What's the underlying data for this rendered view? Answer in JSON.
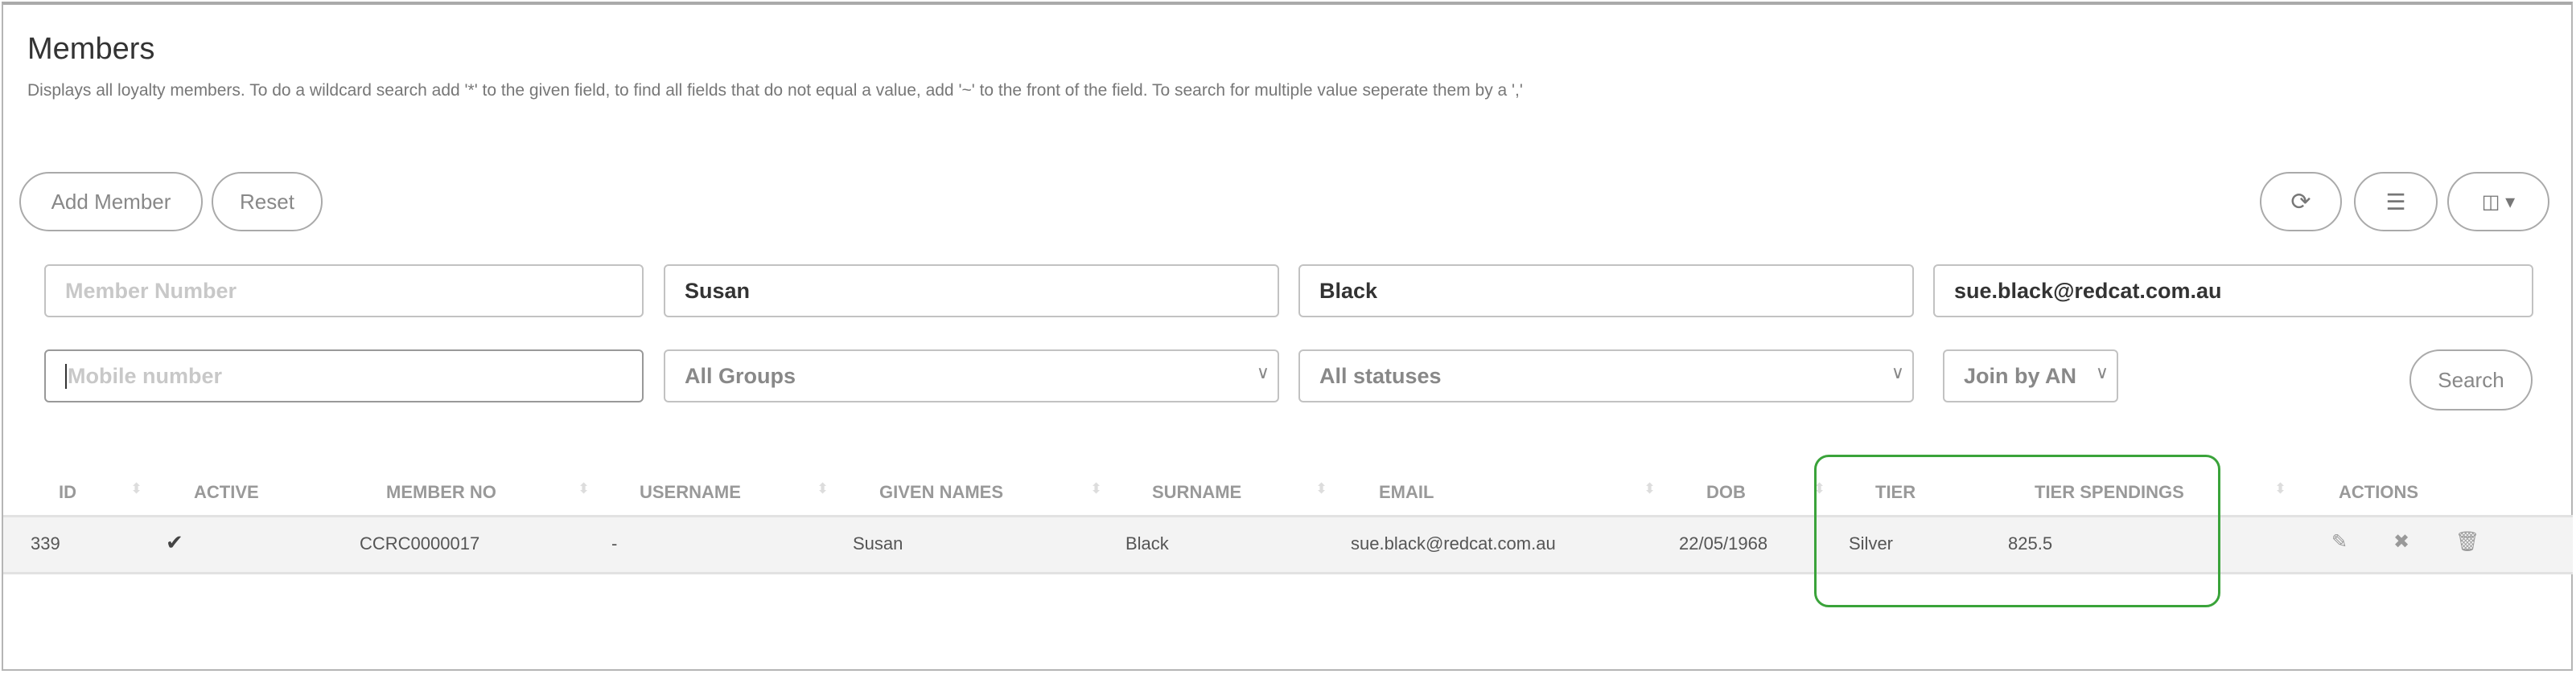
{
  "page": {
    "title": "Members",
    "description": "Displays all loyalty members. To do a wildcard search add '*' to the given field, to find all fields that do not equal a value, add '~' to the front of the field. To search for multiple value seperate them by a ','"
  },
  "toolbar": {
    "add_member": "Add Member",
    "reset": "Reset",
    "refresh_icon": "refresh-icon",
    "list_icon": "list-icon",
    "columns_icon": "columns-icon"
  },
  "filters": {
    "member_number": {
      "placeholder": "Member Number",
      "value": ""
    },
    "given_name": {
      "value": "Susan"
    },
    "surname": {
      "value": "Black"
    },
    "email": {
      "value": "sue.black@redcat.com.au"
    },
    "mobile": {
      "placeholder": "Mobile number",
      "value": ""
    },
    "group": {
      "selected": "All Groups"
    },
    "status": {
      "selected": "All statuses"
    },
    "join": {
      "selected": "Join by AN"
    },
    "search": "Search"
  },
  "table": {
    "columns": [
      "ID",
      "ACTIVE",
      "MEMBER NO",
      "USERNAME",
      "GIVEN NAMES",
      "SURNAME",
      "EMAIL",
      "DOB",
      "TIER",
      "TIER SPENDINGS",
      "ACTIONS"
    ],
    "rows": [
      {
        "id": "339",
        "active": "✔",
        "member_no": "CCRC0000017",
        "username": "-",
        "given_names": "Susan",
        "surname": "Black",
        "email": "sue.black@redcat.com.au",
        "dob": "22/05/1968",
        "tier": "Silver",
        "tier_spendings": "825.5"
      }
    ]
  },
  "highlight_color": "#3aa33a"
}
